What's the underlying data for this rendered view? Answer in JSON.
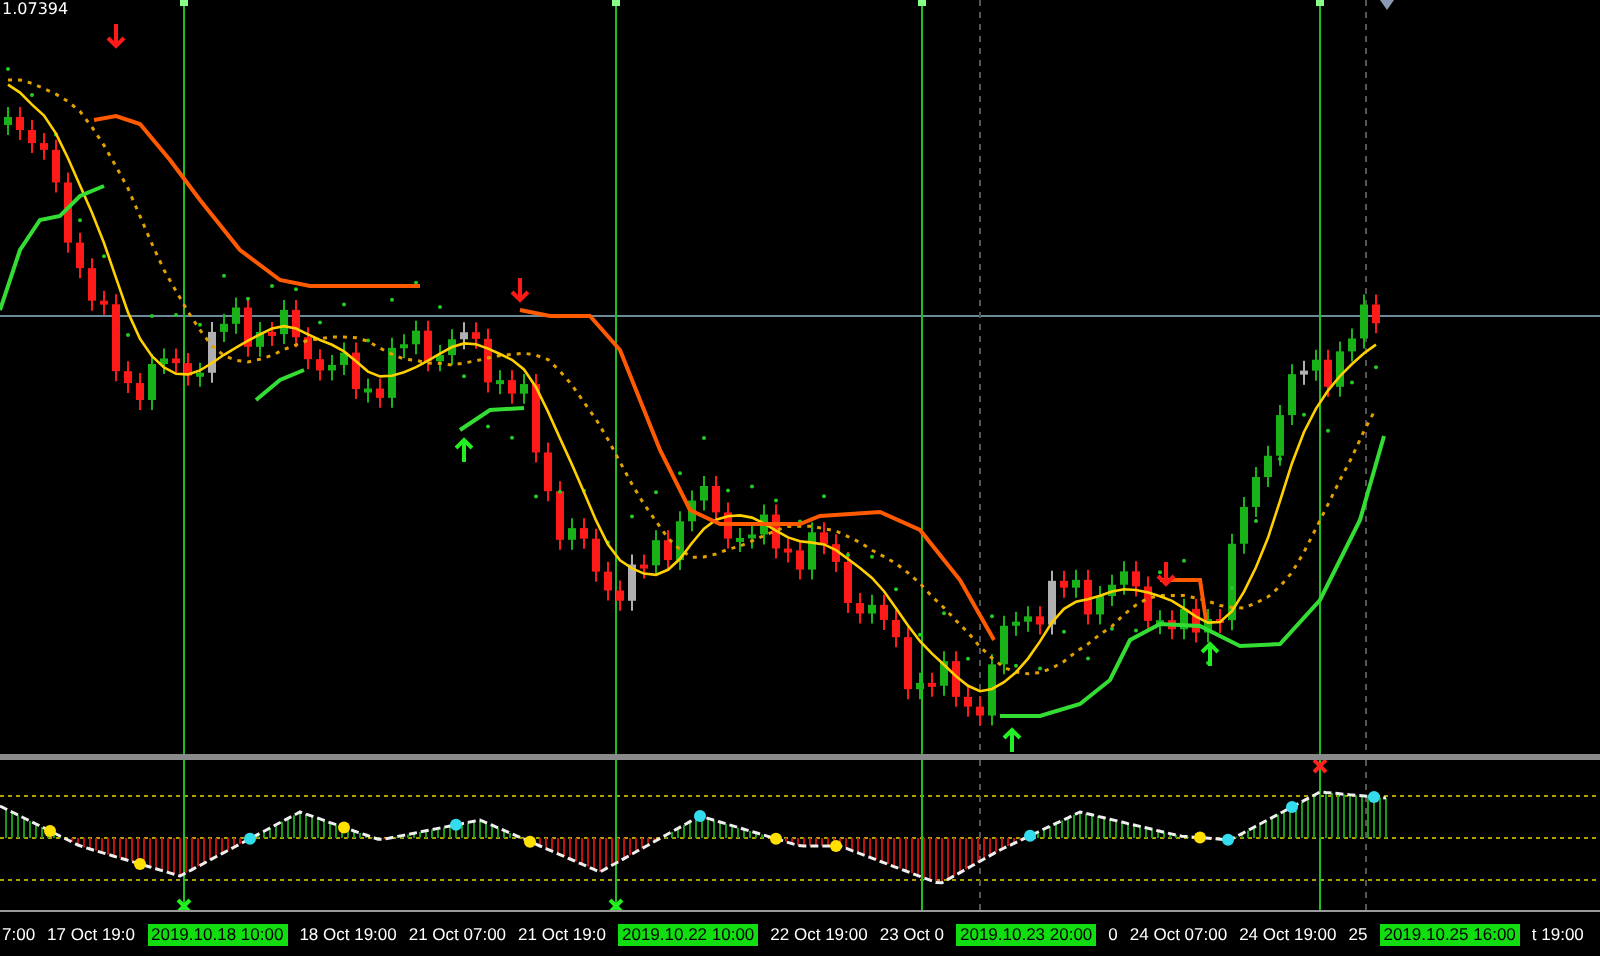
{
  "price_label": "1.07394",
  "time_axis": [
    {
      "text": "7:00",
      "kind": "tick"
    },
    {
      "text": "17 Oct 19:0",
      "kind": "tick"
    },
    {
      "text": "2019.10.18 10:00",
      "kind": "marker"
    },
    {
      "text": "18 Oct 19:00",
      "kind": "tick"
    },
    {
      "text": "21 Oct 07:00",
      "kind": "tick"
    },
    {
      "text": "21 Oct 19:0",
      "kind": "tick"
    },
    {
      "text": "2019.10.22 10:00",
      "kind": "marker"
    },
    {
      "text": "22 Oct 19:00",
      "kind": "tick"
    },
    {
      "text": "23 Oct 0",
      "kind": "tick"
    },
    {
      "text": "2019.10.23 20:00",
      "kind": "marker"
    },
    {
      "text": "0",
      "kind": "tick"
    },
    {
      "text": "24 Oct 07:00",
      "kind": "tick"
    },
    {
      "text": "24 Oct 19:00",
      "kind": "tick"
    },
    {
      "text": "25",
      "kind": "tick"
    },
    {
      "text": "2019.10.25 16:00",
      "kind": "marker"
    },
    {
      "text": "t 19:00",
      "kind": "tick"
    }
  ]
}
